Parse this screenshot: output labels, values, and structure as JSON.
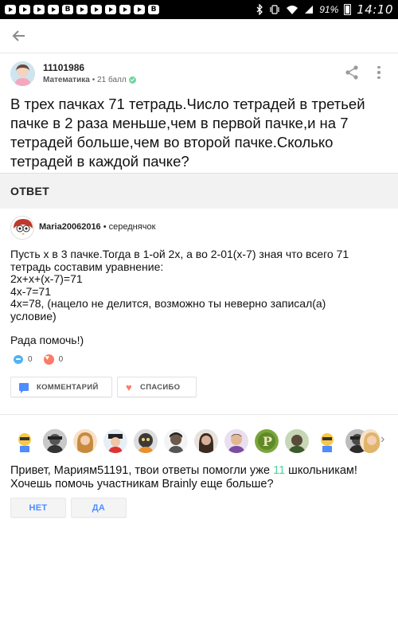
{
  "status_bar": {
    "battery": "91%",
    "time": "14:10",
    "notification_icons": [
      "youtube-icon",
      "youtube-icon",
      "youtube-icon",
      "youtube-icon",
      "vk-icon",
      "youtube-icon",
      "youtube-icon",
      "youtube-icon",
      "youtube-icon",
      "youtube-icon",
      "vk-icon"
    ]
  },
  "question": {
    "username": "11101986",
    "subject": "Математика",
    "points": "• 21 балл",
    "text": "В трех пачках 71 тетрадь.Число тетрадей в третьей пачке в 2 раза меньше,чем в первой пачке,и на 7 тетрадей больше,чем во второй пачке.Сколько тетрадей в каждой пачке?"
  },
  "answer_header": "ОТВЕТ",
  "answer": {
    "username": "Maria20062016",
    "rank": "• середнячок",
    "lines": [
      "Пусть х в 3 пачке.Тогда в 1-ой 2х, а во 2-01(х-7) зная что всего 71",
      "тетрадь составим уравнение:",
      "2х+х+(х-7)=71",
      "4х-7=71",
      "4х=78, (нацело не делится, возможно ты неверно записал(а)",
      "условие)"
    ],
    "thanks_text": "Рада помочь!)",
    "comments_count": "0",
    "likes_count": "0",
    "comment_button": "КОММЕНТАРИЙ",
    "thanks_button": "СПАСИБО"
  },
  "help": {
    "text_before": "Привет, Мариям51191, твои ответы помогли уже ",
    "count": "11",
    "text_after": " школьникам! Хочешь помочь участникам Brainly еще больше?",
    "no_button": "НЕТ",
    "yes_button": "ДА"
  },
  "colors": {
    "accent_blue": "#4e8cff",
    "accent_green": "#4fd29d",
    "heart_red": "#ff7968"
  }
}
